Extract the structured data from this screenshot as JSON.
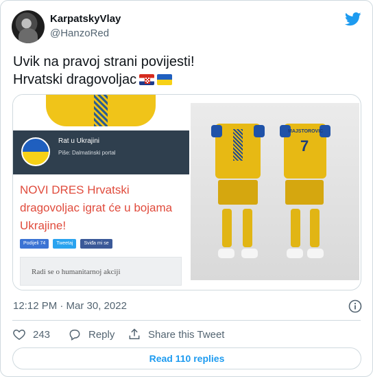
{
  "user": {
    "display_name": "KarpatskyVlay",
    "handle": "@HanzoRed"
  },
  "tweet": {
    "line1": "Uvik na pravoj strani povijesti!",
    "line2": "Hrvatski dragovoljac",
    "flags": [
      "croatia-flag",
      "ukraine-flag"
    ],
    "timestamp": "12:12 PM · Mar 30, 2022"
  },
  "media": {
    "article": {
      "section_title": "Rat u Ukrajini",
      "author": "Piše: Dalmatinski portal",
      "headline": "NOVI DRES Hrvatski dragovoljac igrat će u bojama Ukrajine!",
      "share_facebook": "Podijeli 74",
      "share_twitter": "Tweetaj",
      "like_label": "Sviđa mi se",
      "summary": "Radi se o humanitarnoj akciji"
    },
    "kit": {
      "player_name": "MAJSTOROVIC",
      "number": "7"
    }
  },
  "actions": {
    "like_count": "243",
    "reply_label": "Reply",
    "share_label": "Share this Tweet"
  },
  "read_replies_label": "Read 110 replies",
  "colors": {
    "twitter_blue": "#1d9bf0",
    "ukraine_blue": "#1f5fbf",
    "ukraine_yellow": "#f7d117",
    "headline_red": "#e04b3c"
  }
}
